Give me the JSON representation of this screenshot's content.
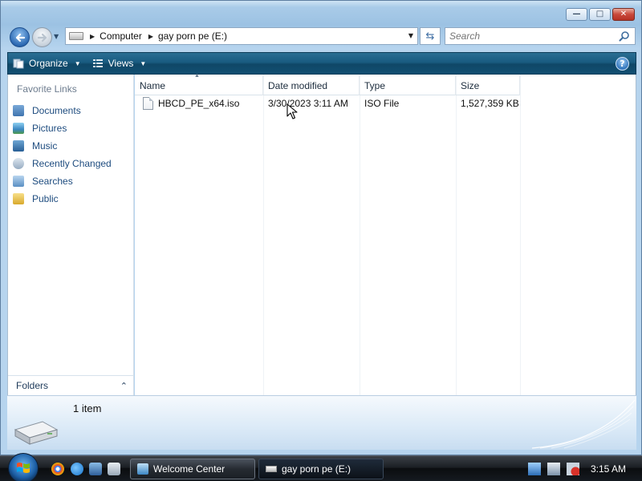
{
  "window": {
    "caption_buttons": [
      {
        "name": "minimize",
        "glyph": "—"
      },
      {
        "name": "maximize",
        "glyph": "□"
      },
      {
        "name": "close",
        "glyph": "✕"
      }
    ]
  },
  "address_bar": {
    "crumbs": [
      "Computer",
      "gay porn pe (E:)"
    ]
  },
  "search": {
    "placeholder": "Search"
  },
  "command_bar": {
    "organize_label": "Organize",
    "views_label": "Views",
    "help_label": "?"
  },
  "nav_pane": {
    "favorites_title": "Favorite Links",
    "items": [
      {
        "label": "Documents",
        "icon": "documents-icon",
        "color": "#5b8fc6"
      },
      {
        "label": "Pictures",
        "icon": "pictures-icon",
        "color": "#4f9bd0"
      },
      {
        "label": "Music",
        "icon": "music-icon",
        "color": "#3b7fb8"
      },
      {
        "label": "Recently Changed",
        "icon": "recent-icon",
        "color": "#8fa8c2"
      },
      {
        "label": "Searches",
        "icon": "searches-icon",
        "color": "#6a9acb"
      },
      {
        "label": "Public",
        "icon": "public-folder-icon",
        "color": "#e8c049"
      }
    ],
    "folders_label": "Folders"
  },
  "file_list": {
    "columns": [
      "Name",
      "Date modified",
      "Type",
      "Size"
    ],
    "rows": [
      {
        "name": "HBCD_PE_x64.iso",
        "date_modified": "3/30/2023 3:11 AM",
        "type": "ISO File",
        "size": "1,527,359 KB"
      }
    ]
  },
  "details_pane": {
    "item_count": "1 item"
  },
  "taskbar": {
    "buttons": [
      {
        "label": "Welcome Center",
        "icon": "welcome-center-icon"
      },
      {
        "label": "gay porn pe (E:)",
        "icon": "drive-icon"
      }
    ],
    "clock": "3:15 AM"
  },
  "colors": {
    "link_text": "#1e4c7f",
    "command_bar": "#195b80",
    "taskbar": "#151a20"
  }
}
